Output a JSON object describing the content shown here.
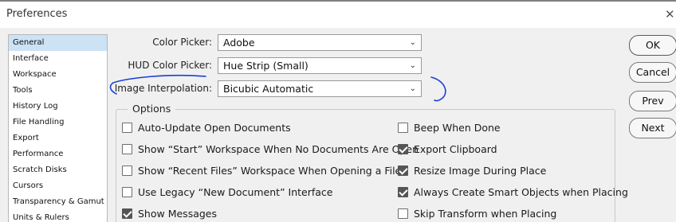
{
  "window": {
    "title": "Preferences"
  },
  "sidebar": {
    "items": [
      {
        "label": "General",
        "selected": true
      },
      {
        "label": "Interface"
      },
      {
        "label": "Workspace"
      },
      {
        "label": "Tools"
      },
      {
        "label": "History Log"
      },
      {
        "label": "File Handling"
      },
      {
        "label": "Export"
      },
      {
        "label": "Performance"
      },
      {
        "label": "Scratch Disks"
      },
      {
        "label": "Cursors"
      },
      {
        "label": "Transparency & Gamut"
      },
      {
        "label": "Units & Rulers"
      }
    ]
  },
  "fields": {
    "color_picker": {
      "label": "Color Picker:",
      "value": "Adobe"
    },
    "hud_color_picker": {
      "label": "HUD Color Picker:",
      "value": "Hue Strip (Small)"
    },
    "image_interpolation": {
      "label": "Image Interpolation:",
      "value": "Bicubic Automatic"
    }
  },
  "options": {
    "title": "Options",
    "left": [
      {
        "label": "Auto-Update Open Documents",
        "checked": false
      },
      {
        "label": "Show “Start” Workspace When No Documents Are Open",
        "checked": false
      },
      {
        "label": "Show “Recent Files” Workspace When Opening a File",
        "checked": false
      },
      {
        "label": "Use Legacy “New Document” Interface",
        "checked": false
      },
      {
        "label": "Show Messages",
        "checked": true
      }
    ],
    "right": [
      {
        "label": "Beep When Done",
        "checked": false
      },
      {
        "label": "Export Clipboard",
        "checked": true
      },
      {
        "label": "Resize Image During Place",
        "checked": true
      },
      {
        "label": "Always Create Smart Objects when Placing",
        "checked": true
      },
      {
        "label": "Skip Transform when Placing",
        "checked": false
      }
    ]
  },
  "buttons": {
    "ok": "OK",
    "cancel": "Cancel",
    "prev": "Prev",
    "next": "Next"
  },
  "colors": {
    "selection": "#cce2f5",
    "annotation_ink": "#1a3fd6",
    "checkbox_checked": "#555555"
  },
  "icons": {
    "close": "close-icon",
    "dropdown": "chevron-down-icon",
    "check": "checkmark-icon"
  }
}
